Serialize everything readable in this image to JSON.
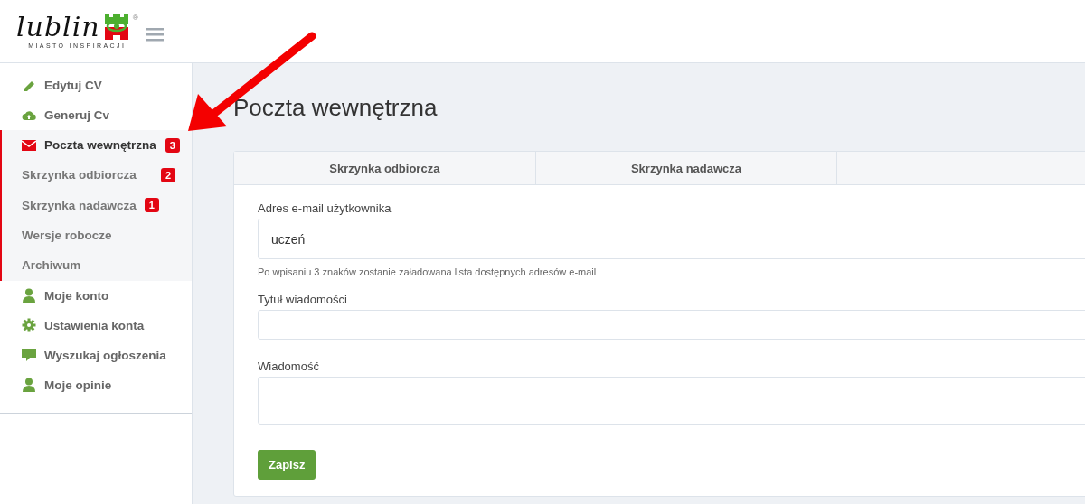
{
  "header": {
    "logo": {
      "wordmark": "lublin",
      "tagline": "MIASTO INSPIRACJI",
      "registered": "®"
    }
  },
  "sidebar": {
    "items": [
      {
        "label": "Edytuj CV",
        "selected": false
      },
      {
        "label": "Generuj Cv",
        "selected": false
      },
      {
        "label": "Poczta wewnętrzna",
        "badge": "3",
        "selected": true,
        "expanded": true,
        "children": [
          {
            "label": "Skrzynka odbiorcza",
            "badge": "2",
            "selected": false
          },
          {
            "label": "Skrzynka nadawcza",
            "badge": "1",
            "selected": false
          },
          {
            "label": "Wersje robocze",
            "selected": false
          },
          {
            "label": "Archiwum",
            "selected": false
          }
        ]
      },
      {
        "label": "Moje konto",
        "selected": false
      },
      {
        "label": "Ustawienia konta",
        "selected": false
      },
      {
        "label": "Wyszukaj ogłoszenia",
        "selected": false
      },
      {
        "label": "Moje opinie",
        "selected": false
      }
    ]
  },
  "page": {
    "title": "Poczta wewnętrzna"
  },
  "tabs": [
    {
      "label": "Skrzynka odbiorcza",
      "selected": false
    },
    {
      "label": "Skrzynka nadawcza",
      "selected": false
    }
  ],
  "form": {
    "fields": [
      {
        "label": "Adres e-mail użytkownika",
        "value": "uczeń",
        "hint": "Po wpisaniu 3 znaków zostanie załadowana lista dostępnych adresów e-mail",
        "kind": "input"
      },
      {
        "label": "Tytuł wiadomości",
        "kind": "input"
      },
      {
        "label": "Wiadomość",
        "kind": "textarea"
      }
    ],
    "submit": "Zapisz"
  }
}
